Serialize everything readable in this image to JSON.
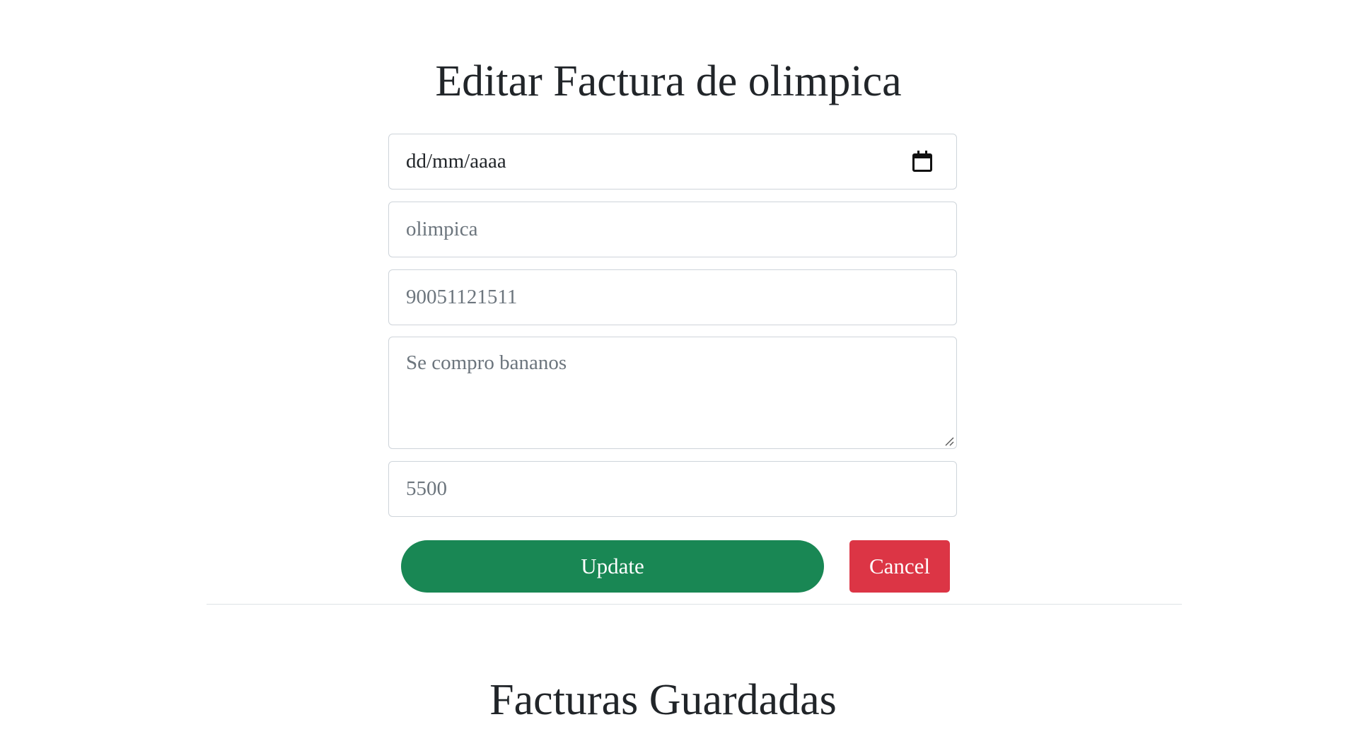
{
  "edit_form": {
    "title": "Editar Factura de olimpica",
    "date_field": {
      "value": "dd/mm/aaaa",
      "icon": "calendar-icon"
    },
    "store_field": {
      "value": "olimpica"
    },
    "nit_field": {
      "value": "90051121511"
    },
    "description_field": {
      "value": "Se compro bananos"
    },
    "total_field": {
      "value": "5500"
    },
    "update_button": {
      "label": "Update",
      "color": "#198754"
    },
    "cancel_button": {
      "label": "Cancel",
      "color": "#dc3545"
    }
  },
  "saved_section": {
    "title": "Facturas Guardadas"
  }
}
